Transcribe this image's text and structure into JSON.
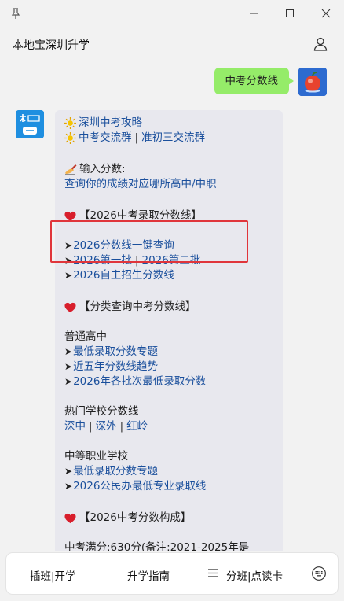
{
  "header": {
    "title": "本地宝深圳升学"
  },
  "user_message": {
    "text": "中考分数线"
  },
  "bot_message": {
    "guide": {
      "label": "深圳中考攻略"
    },
    "groups": {
      "a": "中考交流群",
      "sep": "|",
      "b": "准初三交流群"
    },
    "input_score": {
      "label": "输入分数:",
      "hint": "查询你的成绩对应哪所高中/中职"
    },
    "section1": {
      "title": "【2026中考录取分数线】",
      "l1": "2026分数线一键查询",
      "l2a": "2026第一批",
      "l2sep": "|",
      "l2b": "2026第二批",
      "l3": "2026自主招生分数线"
    },
    "section2": {
      "title": "【分类查询中考分数线】",
      "cat1": "普通高中",
      "c1a": "最低录取分数专题",
      "c1b": "近五年分数线趋势",
      "c1c": "2026年各批次最低录取分数",
      "cat2": "热门学校分数线",
      "s1": "深中",
      "s2": "深外",
      "s3": "红岭",
      "cat3": "中等职业学校",
      "c3a": "最低录取分数专题",
      "c3b": "2026公民办最低专业录取线"
    },
    "section3": {
      "title": "【2026中考分数构成】",
      "text": "中考满分:630分(备注:2021-2025年是"
    }
  },
  "bottom_bar": {
    "tab1": "插班|开学",
    "tab2": "升学指南",
    "tab3": "分班|点读卡"
  },
  "colors": {
    "user_bubble": "#95ec69",
    "link": "#1a4f9c",
    "highlight": "#e0353b"
  }
}
